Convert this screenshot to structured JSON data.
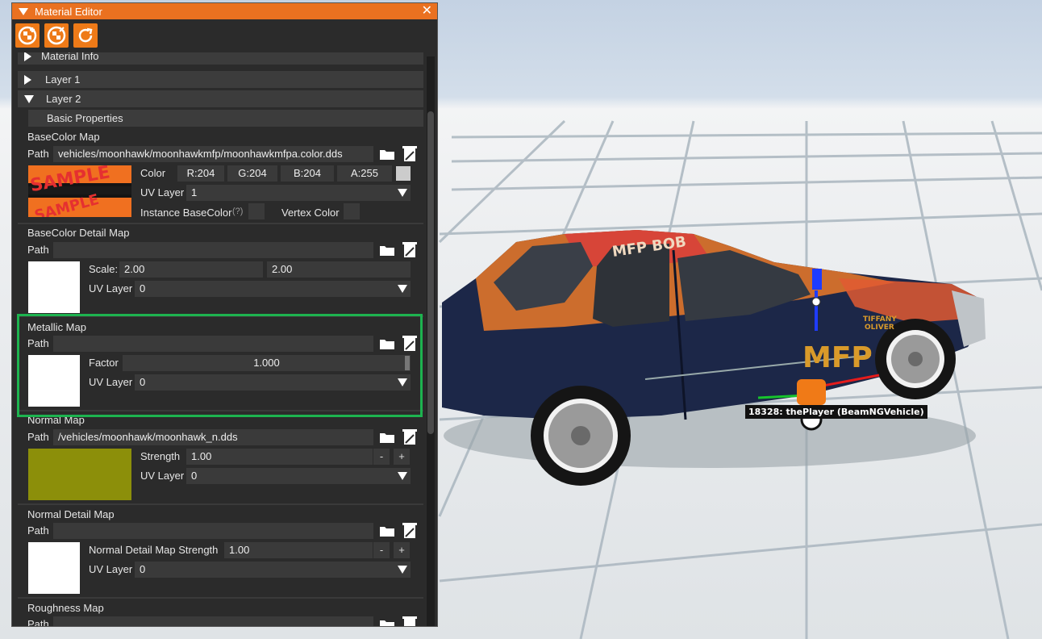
{
  "window": {
    "title": "Material Editor",
    "toolbar": {
      "icons": [
        "add-material-icon",
        "add-checker-icon",
        "reload-icon"
      ]
    }
  },
  "tree": {
    "material_info": "Material Info",
    "layer1": "Layer 1",
    "layer2": "Layer 2",
    "basic_properties": "Basic Properties"
  },
  "basecolor_map": {
    "title": "BaseColor Map",
    "path_label": "Path",
    "path": "vehicles/moonhawk/moonhawkmfp/moonhawkmfpa.color.dds",
    "color_label": "Color",
    "r": "R:204",
    "g": "G:204",
    "b": "B:204",
    "a": "A:255",
    "swatch_color": "#cccccc",
    "uv_label": "UV Layer",
    "uv_value": "1",
    "instance_label": "Instance BaseColor",
    "help": "(?)",
    "vertex_label": "Vertex Color"
  },
  "basecolor_detail_map": {
    "title": "BaseColor Detail Map",
    "path_label": "Path",
    "path": "",
    "scale_label": "Scale:",
    "scale_x": "2.00",
    "scale_y": "2.00",
    "uv_label": "UV Layer",
    "uv_value": "0"
  },
  "metallic_map": {
    "title": "Metallic Map",
    "path_label": "Path",
    "path": "",
    "factor_label": "Factor",
    "factor_value": "1.000",
    "uv_label": "UV Layer",
    "uv_value": "0"
  },
  "normal_map": {
    "title": "Normal Map",
    "path_label": "Path",
    "path": "/vehicles/moonhawk/moonhawk_n.dds",
    "strength_label": "Strength",
    "strength_value": "1.00",
    "minus": "-",
    "plus": "+",
    "uv_label": "UV Layer",
    "uv_value": "0"
  },
  "normal_detail_map": {
    "title": "Normal Detail Map",
    "path_label": "Path",
    "path": "",
    "strength_label": "Normal Detail Map Strength",
    "strength_value": "1.00",
    "minus": "-",
    "plus": "+",
    "uv_label": "UV Layer",
    "uv_value": "0"
  },
  "roughness_map": {
    "title": "Roughness Map",
    "path_label": "Path"
  },
  "viewport": {
    "vehicle_label": "18328: thePlayer (BeamNGVehicle)",
    "plate_text": "MFP",
    "roof_text": "MFP BOB",
    "driver_text": "TIFFANY OLIVER"
  },
  "colors": {
    "accent": "#ea7120",
    "panel": "#2b2b2b",
    "highlight": "#1db34f"
  }
}
